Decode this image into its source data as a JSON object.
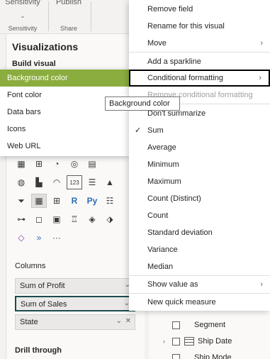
{
  "ribbon": {
    "sensitivity_big": "Sensitivity",
    "sensitivity_caption": "Sensitivity",
    "publish_big": "Publish",
    "share_caption": "Share"
  },
  "viz_pane": {
    "title": "Visualizations",
    "build_visual": "Build visual",
    "icon_rows": [
      [
        "table-icon",
        "matrix-icon",
        "pie-icon",
        "donut-icon",
        "treemap-icon"
      ],
      [
        "map-icon",
        "filled-map-icon",
        "gauge-icon",
        "card-icon",
        "multirow-card-icon",
        "kpi-icon"
      ],
      [
        "slicer-icon",
        "table-visual-icon",
        "matrix-visual-icon",
        "r-visual-icon",
        "python-visual-icon",
        "narrative-icon"
      ],
      [
        "decomposition-tree-icon",
        "qa-icon",
        "paginated-icon",
        "goals-icon",
        "powerapps-icon",
        "powerautomate-icon"
      ],
      [
        "diamond-icon",
        "chevron-visual-icon",
        "more-visuals-icon"
      ]
    ],
    "icon_glyphs": {
      "r": "R",
      "py": "Py",
      "more": "···"
    },
    "columns_label": "Columns",
    "wells": [
      {
        "label": "Sum of Profit"
      },
      {
        "label": "Sum of Sales"
      },
      {
        "label": "State"
      }
    ],
    "drill_through": "Drill through"
  },
  "submenu": {
    "items": [
      "Background color",
      "Font color",
      "Data bars",
      "Icons",
      "Web URL"
    ],
    "highlight_color": "#8bad3f"
  },
  "tooltip": {
    "text": "Background color"
  },
  "context_menu": {
    "items": [
      {
        "label": "Remove field"
      },
      {
        "label": "Rename for this visual"
      },
      {
        "label": "Move",
        "arrow": "›"
      },
      {
        "label": "Add a sparkline"
      },
      {
        "label": "Conditional formatting",
        "arrow": "›"
      },
      {
        "label": "Remove conditional formatting",
        "disabled": true
      },
      {
        "label": "Don't summarize"
      },
      {
        "label": "Sum",
        "checked": "✓"
      },
      {
        "label": "Average"
      },
      {
        "label": "Minimum"
      },
      {
        "label": "Maximum"
      },
      {
        "label": "Count (Distinct)"
      },
      {
        "label": "Count"
      },
      {
        "label": "Standard deviation"
      },
      {
        "label": "Variance"
      },
      {
        "label": "Median"
      },
      {
        "label": "Show value as",
        "arrow": "›"
      },
      {
        "label": "New quick measure"
      }
    ]
  },
  "fields_pane": {
    "rows": [
      {
        "label": "Segment"
      },
      {
        "label": "Ship Date",
        "expand": "›"
      },
      {
        "label": "Ship Mode"
      }
    ]
  }
}
